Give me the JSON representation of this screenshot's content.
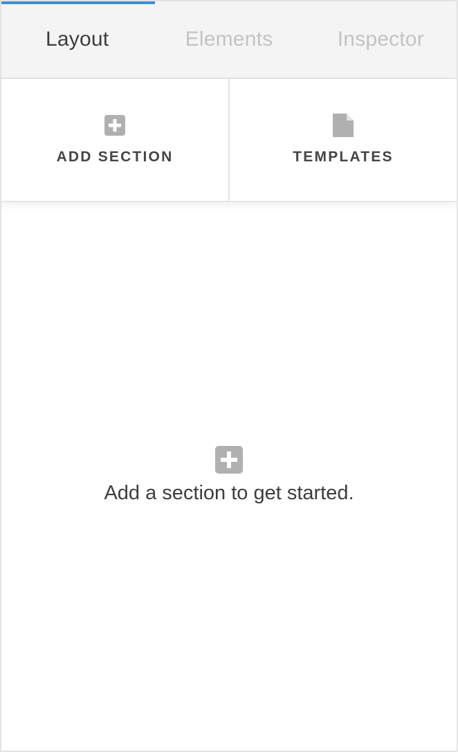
{
  "tabs": [
    {
      "label": "Layout",
      "active": true
    },
    {
      "label": "Elements",
      "active": false
    },
    {
      "label": "Inspector",
      "active": false
    }
  ],
  "actions": {
    "add_section": {
      "label": "ADD SECTION",
      "icon": "plus-square-icon"
    },
    "templates": {
      "label": "TEMPLATES",
      "icon": "file-icon"
    }
  },
  "empty_state": {
    "icon": "plus-square-icon",
    "message": "Add a section to get started."
  },
  "colors": {
    "accent": "#3d8fd8",
    "icon_gray": "#b0b0b0",
    "text_dark": "#3d3d3d",
    "tab_inactive": "#c3c3c3"
  }
}
